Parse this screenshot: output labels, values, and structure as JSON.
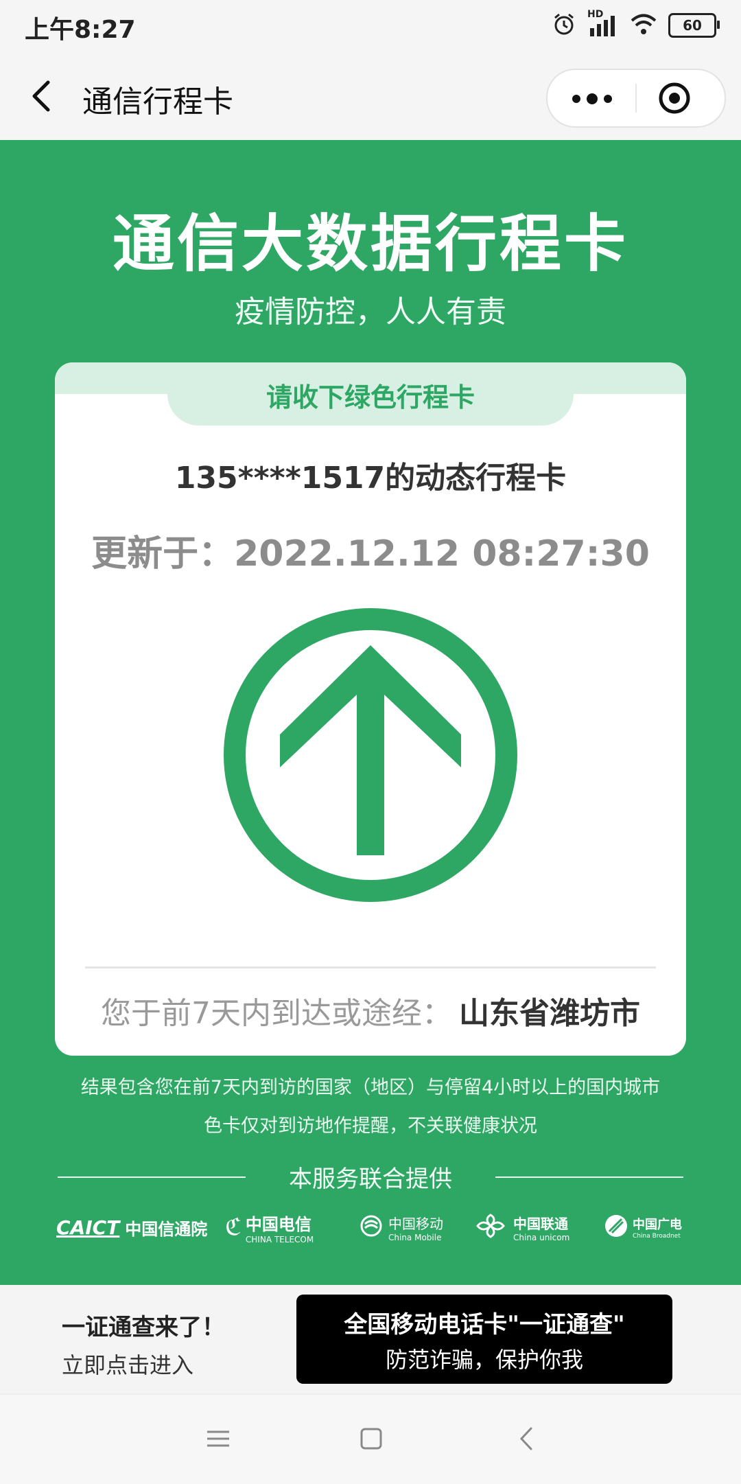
{
  "status_bar": {
    "time": "上午8:27",
    "network_label": "HD",
    "battery": "60",
    "icons": [
      "alarm-icon",
      "signal-icon",
      "wifi-icon",
      "battery-icon"
    ]
  },
  "nav": {
    "title": "通信行程卡",
    "icons": [
      "back-icon",
      "more-icon",
      "close-mini-program-icon"
    ]
  },
  "hero": {
    "title": "通信大数据行程卡",
    "subtitle": "疫情防控，人人有责"
  },
  "card": {
    "tab_label": "请收下绿色行程卡",
    "phone_line": "135****1517的动态行程卡",
    "updated_line": "更新于：2022.12.12 08:27:30",
    "status_icon": "green-up-arrow-icon",
    "footer_prefix": "您于前7天内到达或途经：",
    "footer_city": "山东省潍坊市"
  },
  "notes": {
    "line1": "结果包含您在前7天内到访的国家（地区）与停留4小时以上的国内城市",
    "line2": "色卡仅对到访地作提醒，不关联健康状况"
  },
  "providers": {
    "label": "本服务联合提供",
    "logos": [
      {
        "mark": "CAICT",
        "name": "中国信通院",
        "sub": ""
      },
      {
        "mark": "",
        "name": "中国电信",
        "sub": "CHINA TELECOM"
      },
      {
        "mark": "",
        "name": "中国移动",
        "sub": "China Mobile"
      },
      {
        "mark": "",
        "name": "中国联通",
        "sub": "China unicom"
      },
      {
        "mark": "",
        "name": "中国广电",
        "sub": "China Broadnet"
      }
    ]
  },
  "banner": {
    "title": "一证通查来了！",
    "subtitle": "立即点击进入",
    "cta_line1": "全国移动电话卡\"一证通查\"",
    "cta_line2": "防范诈骗，保护你我"
  },
  "colors": {
    "brand_green": "#2ea664",
    "tab_tint": "#d8f0e3"
  }
}
